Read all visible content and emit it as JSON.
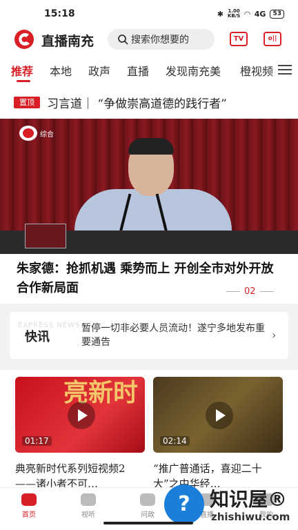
{
  "status_bar": {
    "time": "15:18",
    "speed": "1.00\nKB/S",
    "signal": "4G",
    "battery": "53"
  },
  "header": {
    "brand": "直播南充",
    "search_placeholder": "搜索你想要的",
    "tv_label": "TV",
    "radio_label": "o||"
  },
  "tabs": [
    "推荐",
    "本地",
    "政声",
    "直播",
    "发现南充美",
    "橙视频"
  ],
  "pinned": {
    "badge": "置顶",
    "text": "习言道｜ “争做崇高道德的践行者”"
  },
  "hero": {
    "channel_label": "综合",
    "headline": "朱家德：抢抓机遇 乘势而上 开创全市对外开放合作新局面",
    "page": "02"
  },
  "express": {
    "bg_label": "EXPRESS NEWS",
    "label": "快讯",
    "text": "暂停一切非必要人员流动！遂宁多地发布重要通告"
  },
  "videos": [
    {
      "duration": "01:17",
      "title": "典亮新时代系列短视频2——诸小者不可…",
      "deco": "亮新时"
    },
    {
      "duration": "02:14",
      "title": "“推广普通话，喜迎二十大”之中华经…",
      "deco": ""
    }
  ],
  "bottom_nav": [
    {
      "label": "首页",
      "active": true
    },
    {
      "label": "视听",
      "active": false
    },
    {
      "label": "问政",
      "active": false
    },
    {
      "label": "直播",
      "active": false
    },
    {
      "label": "我的",
      "active": false
    }
  ],
  "watermark": {
    "icon": "?",
    "cn": "知识屋®",
    "en": "zhishiwu.com"
  },
  "colors": {
    "accent": "#d81f26"
  }
}
